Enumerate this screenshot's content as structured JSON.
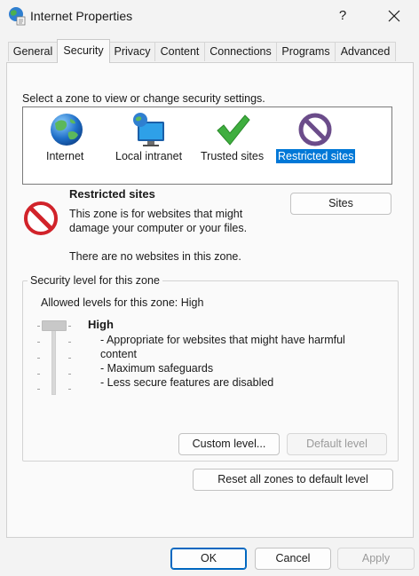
{
  "window": {
    "title": "Internet Properties",
    "help_label": "?",
    "close_icon": "close-icon"
  },
  "tabs": [
    {
      "label": "General",
      "active": false
    },
    {
      "label": "Security",
      "active": true
    },
    {
      "label": "Privacy",
      "active": false
    },
    {
      "label": "Content",
      "active": false
    },
    {
      "label": "Connections",
      "active": false
    },
    {
      "label": "Programs",
      "active": false
    },
    {
      "label": "Advanced",
      "active": false
    }
  ],
  "security": {
    "zone_prompt": "Select a zone to view or change security settings.",
    "zones": [
      {
        "label": "Internet",
        "icon": "globe-icon",
        "selected": false
      },
      {
        "label": "Local intranet",
        "icon": "intranet-icon",
        "selected": false
      },
      {
        "label": "Trusted sites",
        "icon": "checkmark-icon",
        "selected": false
      },
      {
        "label": "Restricted sites",
        "icon": "restricted-icon",
        "selected": true
      }
    ],
    "selected_zone": {
      "title": "Restricted sites",
      "description_line1": "This zone is for websites that might",
      "description_line2": "damage your computer or your files.",
      "status": "There are no websites in this zone.",
      "icon": "no-entry-icon",
      "sites_button": "Sites"
    },
    "level_group": {
      "legend": "Security level for this zone",
      "allowed": "Allowed levels for this zone: High",
      "slider_level": "High",
      "level_name": "High",
      "description": [
        "- Appropriate for websites that might have harmful",
        "content",
        "- Maximum safeguards",
        "- Less secure features are disabled"
      ],
      "custom_button": "Custom level...",
      "default_button": "Default level"
    },
    "reset_button": "Reset all zones to default level"
  },
  "footer": {
    "ok": "OK",
    "cancel": "Cancel",
    "apply": "Apply"
  },
  "colors": {
    "selection": "#0078d7",
    "default_button_border": "#0067c0",
    "no_entry_red": "#d1232a"
  }
}
